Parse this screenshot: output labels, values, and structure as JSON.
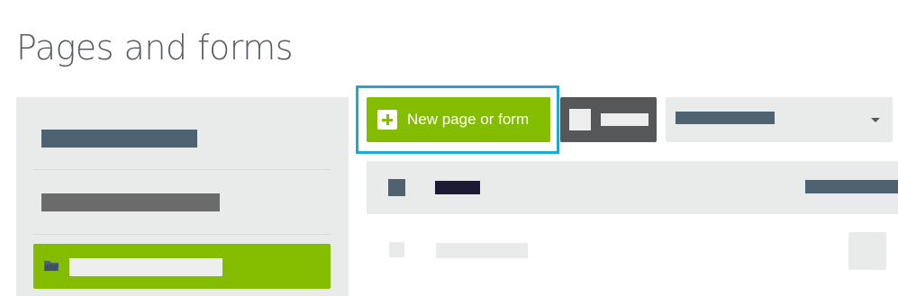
{
  "header": {
    "title": "Pages and forms"
  },
  "toolbar": {
    "new_button_label": "New page or form",
    "new_button_icon": "plus-icon",
    "accent_color": "#84bd00",
    "highlight_color": "#1ea7d2",
    "select_icon": "chevron-down-icon"
  },
  "sidebar": {
    "active_item_icon": "folder-icon",
    "active_color": "#84bd00"
  }
}
